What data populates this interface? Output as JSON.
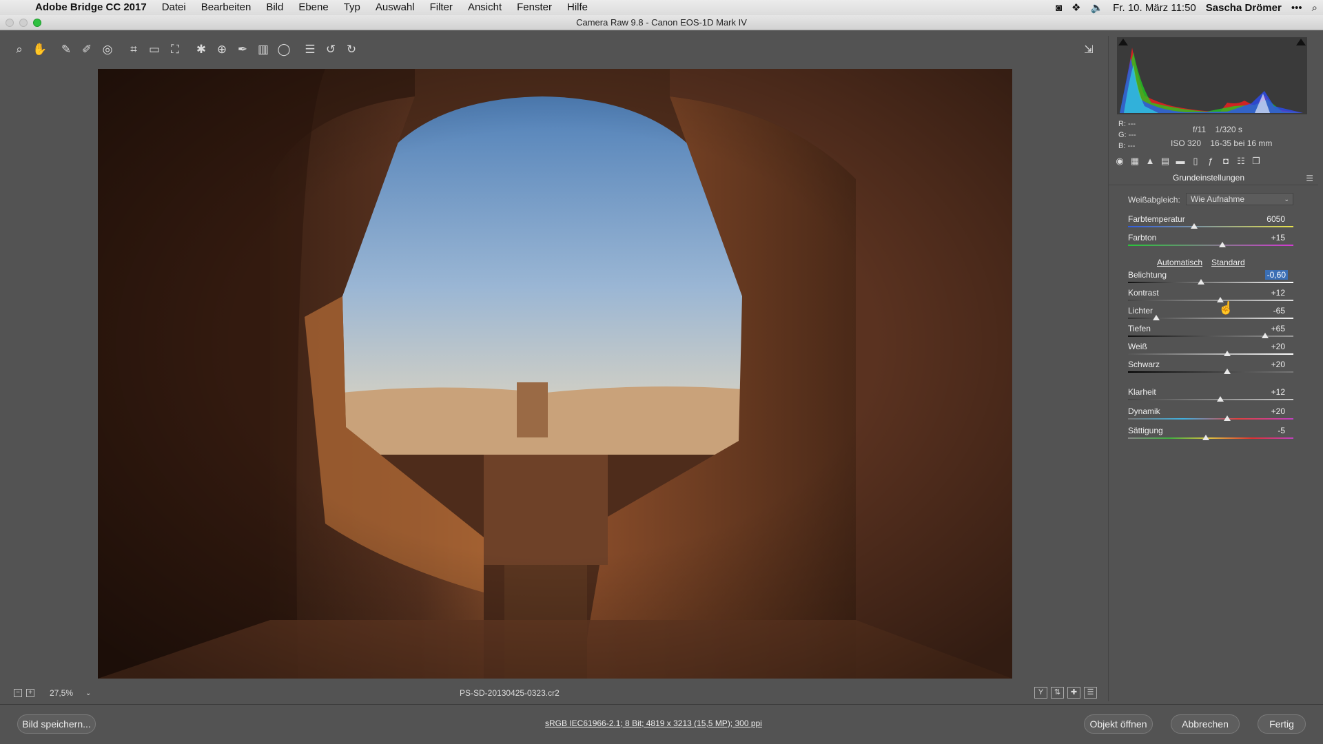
{
  "menubar": {
    "app_name": "Adobe Bridge CC 2017",
    "items": [
      "Datei",
      "Bearbeiten",
      "Bild",
      "Ebene",
      "Typ",
      "Auswahl",
      "Filter",
      "Ansicht",
      "Fenster",
      "Hilfe"
    ],
    "datetime": "Fr. 10. März 11:50",
    "user": "Sascha Drömer"
  },
  "window": {
    "title": "Camera Raw 9.8 - Canon EOS-1D Mark IV"
  },
  "histogram": {
    "r": "R:  ---",
    "g": "G:  ---",
    "b": "B:  ---",
    "aperture": "f/11",
    "shutter": "1/320 s",
    "iso": "ISO 320",
    "lens": "16-35 bei 16 mm"
  },
  "panel": {
    "section_title": "Grundeinstellungen",
    "wb_label": "Weißabgleich:",
    "wb_value": "Wie Aufnahme",
    "auto_link": "Automatisch",
    "standard_link": "Standard",
    "sliders": [
      {
        "label": "Farbtemperatur",
        "value": "6050",
        "pos": 0.4
      },
      {
        "label": "Farbton",
        "value": "+15",
        "pos": 0.57
      },
      {
        "label": "Belichtung",
        "value": "-0,60",
        "pos": 0.44
      },
      {
        "label": "Kontrast",
        "value": "+12",
        "pos": 0.56
      },
      {
        "label": "Lichter",
        "value": "-65",
        "pos": 0.17
      },
      {
        "label": "Tiefen",
        "value": "+65",
        "pos": 0.83
      },
      {
        "label": "Weiß",
        "value": "+20",
        "pos": 0.6
      },
      {
        "label": "Schwarz",
        "value": "+20",
        "pos": 0.6
      },
      {
        "label": "Klarheit",
        "value": "+12",
        "pos": 0.56
      },
      {
        "label": "Dynamik",
        "value": "+20",
        "pos": 0.6
      },
      {
        "label": "Sättigung",
        "value": "-5",
        "pos": 0.47
      }
    ]
  },
  "statusbar": {
    "zoom": "27,5%",
    "filename": "PS-SD-20130425-0323.cr2"
  },
  "footer": {
    "save_button": "Bild speichern...",
    "workflow_link": "sRGB IEC61966-2.1; 8 Bit; 4819 x 3213 (15,5 MP); 300 ppi",
    "open_button": "Objekt öffnen",
    "cancel_button": "Abbrechen",
    "done_button": "Fertig"
  }
}
